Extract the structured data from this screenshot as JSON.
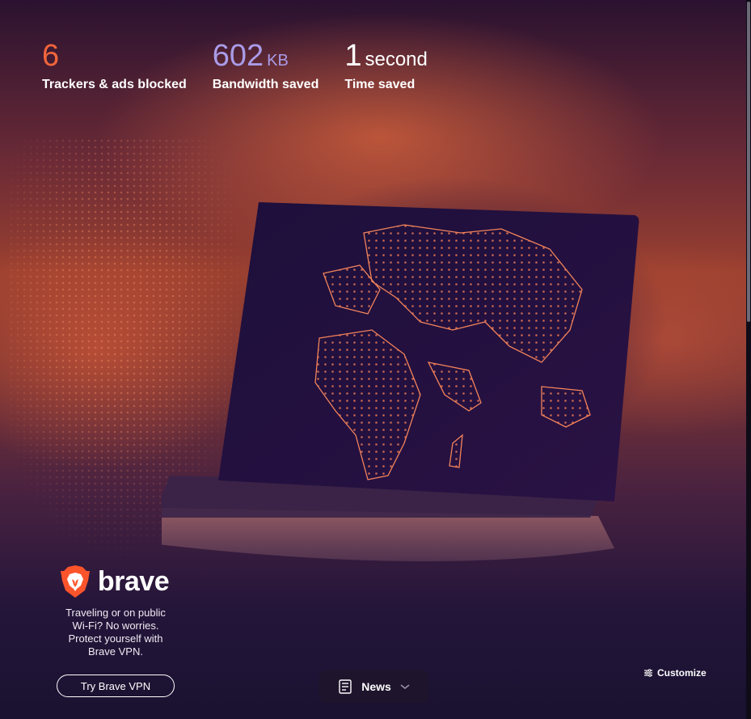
{
  "stats": [
    {
      "value": "6",
      "unit": "",
      "label": "Trackers & ads blocked",
      "color": "#f2653a"
    },
    {
      "value": "602",
      "unit": "KB",
      "label": "Bandwidth saved",
      "color": "#a99be8"
    },
    {
      "value": "1",
      "unit": "second",
      "label": "Time saved",
      "color": "#ffffff"
    }
  ],
  "promo": {
    "brand": "brave",
    "text": "Traveling or on public Wi-Fi? No worries. Protect yourself with Brave VPN.",
    "button": "Try Brave VPN"
  },
  "news": {
    "label": "News",
    "icon": "newspaper-icon",
    "chevron": "chevron-down-icon"
  },
  "customize": {
    "label": "Customize",
    "icon": "sliders-icon"
  },
  "colors": {
    "brand_orange": "#fb542b",
    "map_line": "#ff8a5c"
  }
}
